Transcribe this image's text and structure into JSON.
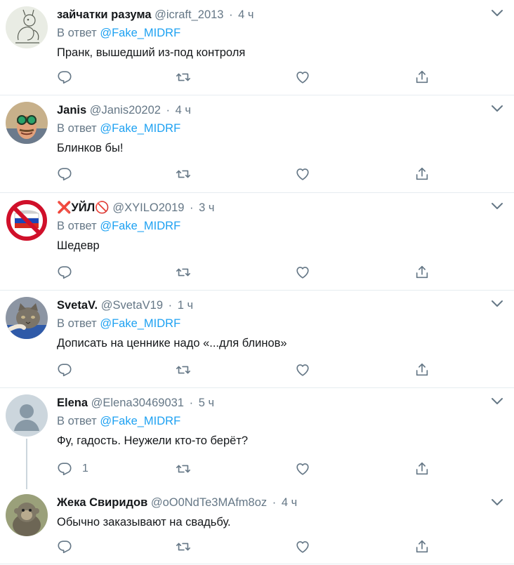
{
  "colors": {
    "accent": "#1da1f2",
    "muted": "#657786",
    "text": "#14171a",
    "divider": "#e6ecf0",
    "flag_red": "#e0245e"
  },
  "tweets": [
    {
      "avatar": "avatar-sketch",
      "name": "зайчатки разума",
      "handle": "@icraft_2013",
      "time": "4 ч",
      "reply_prefix": "В ответ",
      "mention": "@Fake_MIDRF",
      "text": "Пранк, вышедший из-под контроля",
      "reply_count": ""
    },
    {
      "avatar": "avatar-man-goggles",
      "name": "Janis",
      "handle": "@Janis20202",
      "time": "4 ч",
      "reply_prefix": "В ответ",
      "mention": "@Fake_MIDRF",
      "text": "Блинков бы!",
      "reply_count": ""
    },
    {
      "avatar": "avatar-prohibited-flag",
      "name_prefix_icon": "cross-mark-icon",
      "name": "УЙЛ",
      "name_suffix_icon": "no-entry-icon",
      "handle": "@XYILO2019",
      "time": "3 ч",
      "reply_prefix": "В ответ",
      "mention": "@Fake_MIDRF",
      "text": "Шедевр",
      "reply_count": ""
    },
    {
      "avatar": "avatar-cat",
      "name": "SvetaV.",
      "handle": "@SvetaV19",
      "time": "1 ч",
      "reply_prefix": "В ответ",
      "mention": "@Fake_MIDRF",
      "text": "Дописать на ценнике надо «...для блинов»",
      "reply_count": ""
    },
    {
      "avatar": "avatar-default",
      "name": "Elena",
      "handle": "@Elena30469031",
      "time": "5 ч",
      "reply_prefix": "В ответ",
      "mention": "@Fake_MIDRF",
      "text": "Фу, гадость. Неужели кто-то берёт?",
      "reply_count": "1"
    },
    {
      "avatar": "avatar-monkey",
      "name": "Жека Свиридов",
      "handle": "@oO0NdTe3MAfm8oz",
      "time": "4 ч",
      "reply_prefix": "",
      "mention": "",
      "text": "Обычно заказывают на свадьбу.",
      "reply_count": ""
    }
  ],
  "separator": "·"
}
